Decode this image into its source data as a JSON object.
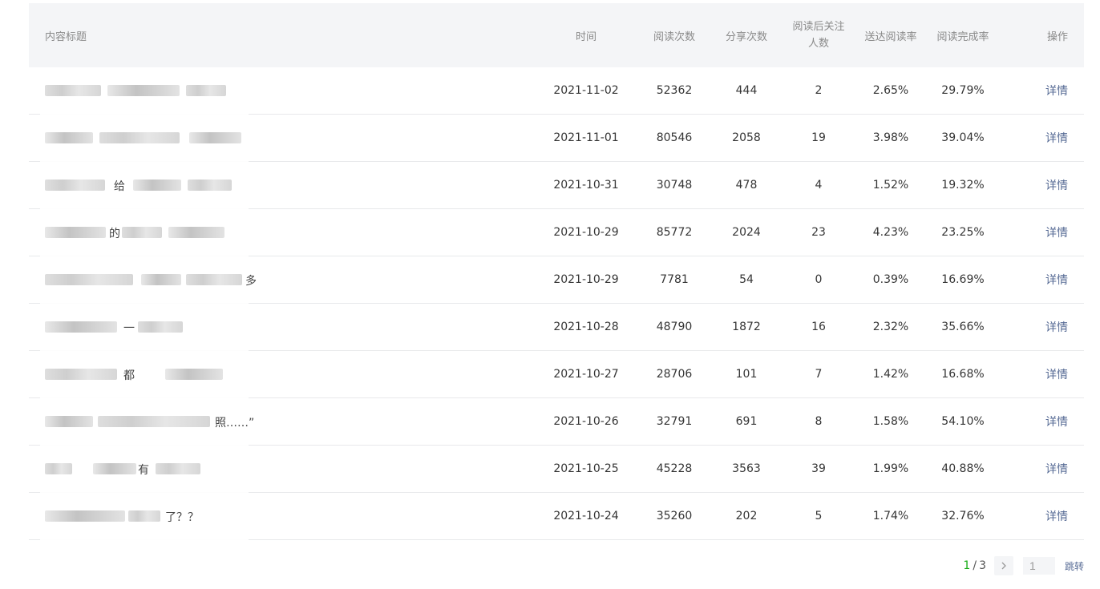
{
  "table": {
    "headers": {
      "title": "内容标题",
      "time": "时间",
      "reads": "阅读次数",
      "shares": "分享次数",
      "follow_line1": "阅读后关注",
      "follow_line2": "人数",
      "reach_rate": "送达阅读率",
      "completion_rate": "阅读完成率",
      "operation": "操作"
    },
    "rows": [
      {
        "title_visible": "",
        "time": "2021-11-02",
        "reads": "52362",
        "shares": "444",
        "follow": "2",
        "reach_rate": "2.65%",
        "completion_rate": "29.79%",
        "action": "详情"
      },
      {
        "title_visible": "",
        "time": "2021-11-01",
        "reads": "80546",
        "shares": "2058",
        "follow": "19",
        "reach_rate": "3.98%",
        "completion_rate": "39.04%",
        "action": "详情"
      },
      {
        "title_visible": "给",
        "time": "2021-10-31",
        "reads": "30748",
        "shares": "478",
        "follow": "4",
        "reach_rate": "1.52%",
        "completion_rate": "19.32%",
        "action": "详情"
      },
      {
        "title_visible": "的",
        "time": "2021-10-29",
        "reads": "85772",
        "shares": "2024",
        "follow": "23",
        "reach_rate": "4.23%",
        "completion_rate": "23.25%",
        "action": "详情"
      },
      {
        "title_visible": "多",
        "time": "2021-10-29",
        "reads": "7781",
        "shares": "54",
        "follow": "0",
        "reach_rate": "0.39%",
        "completion_rate": "16.69%",
        "action": "详情"
      },
      {
        "title_visible": "一",
        "time": "2021-10-28",
        "reads": "48790",
        "shares": "1872",
        "follow": "16",
        "reach_rate": "2.32%",
        "completion_rate": "35.66%",
        "action": "详情"
      },
      {
        "title_visible": "都",
        "time": "2021-10-27",
        "reads": "28706",
        "shares": "101",
        "follow": "7",
        "reach_rate": "1.42%",
        "completion_rate": "16.68%",
        "action": "详情"
      },
      {
        "title_visible": "照……”",
        "time": "2021-10-26",
        "reads": "32791",
        "shares": "691",
        "follow": "8",
        "reach_rate": "1.58%",
        "completion_rate": "54.10%",
        "action": "详情"
      },
      {
        "title_visible": "有",
        "time": "2021-10-25",
        "reads": "45228",
        "shares": "3563",
        "follow": "39",
        "reach_rate": "1.99%",
        "completion_rate": "40.88%",
        "action": "详情"
      },
      {
        "title_visible": "了？？",
        "time": "2021-10-24",
        "reads": "35260",
        "shares": "202",
        "follow": "5",
        "reach_rate": "1.74%",
        "completion_rate": "32.76%",
        "action": "详情"
      }
    ]
  },
  "pagination": {
    "current": "1",
    "separator": "/",
    "total": "3",
    "next_icon": "chevron-right-icon",
    "input_value": "1",
    "jump_label": "跳转"
  }
}
